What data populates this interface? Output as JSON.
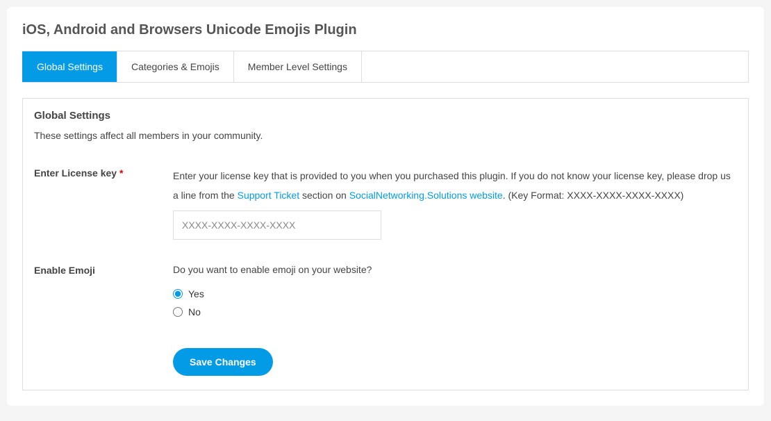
{
  "header": {
    "title": "iOS, Android and Browsers Unicode Emojis Plugin"
  },
  "tabs": [
    {
      "label": "Global Settings",
      "active": true
    },
    {
      "label": "Categories & Emojis",
      "active": false
    },
    {
      "label": "Member Level Settings",
      "active": false
    }
  ],
  "section": {
    "heading": "Global Settings",
    "description": "These settings affect all members in your community."
  },
  "fields": {
    "license": {
      "label": "Enter License key",
      "required_mark": "*",
      "desc_pre": "Enter your license key that is provided to you when you purchased this plugin. If you do not know your license key, please drop us a line from the ",
      "link1": "Support Ticket",
      "desc_mid": " section on ",
      "link2": "SocialNetworking.Solutions website",
      "desc_post": ". (Key Format: XXXX-XXXX-XXXX-XXXX)",
      "placeholder": "XXXX-XXXX-XXXX-XXXX",
      "value": ""
    },
    "enable_emoji": {
      "label": "Enable Emoji",
      "question": "Do you want to enable emoji on your website?",
      "options": {
        "yes": "Yes",
        "no": "No"
      },
      "selected": "yes"
    }
  },
  "buttons": {
    "save": "Save Changes"
  }
}
